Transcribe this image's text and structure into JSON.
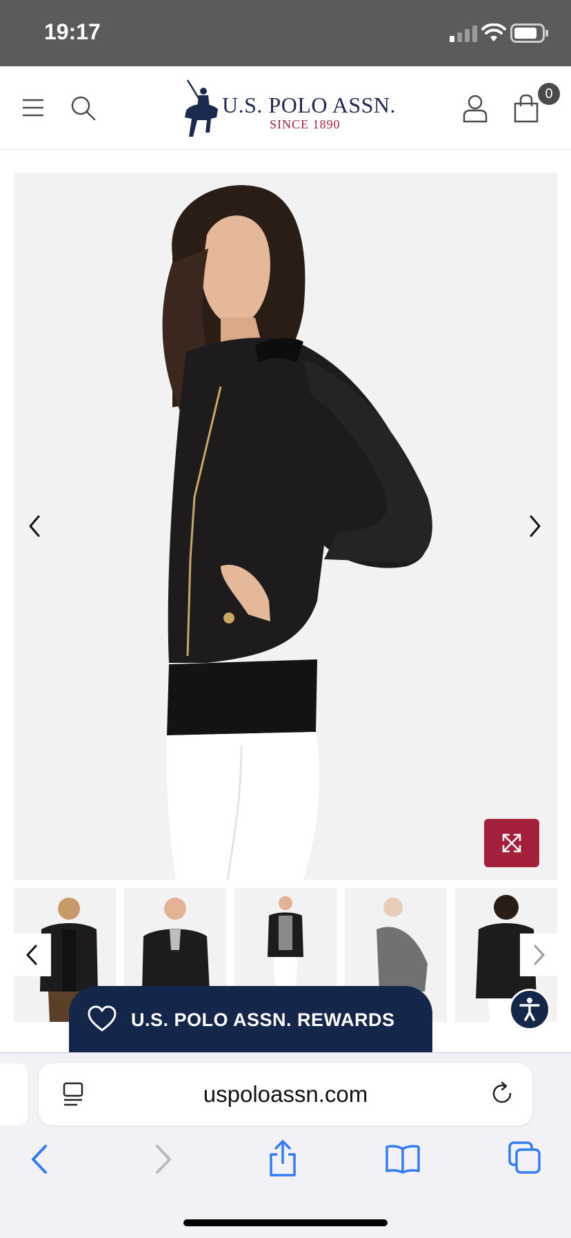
{
  "status_bar": {
    "time": "19:17",
    "icons": [
      "signal-icon",
      "wifi-icon",
      "battery-icon"
    ]
  },
  "header": {
    "menu_icon": "hamburger-menu-icon",
    "search_icon": "search-icon",
    "logo_name": "U.S. POLO ASSN.",
    "logo_since": "SINCE 1890",
    "account_icon": "user-icon",
    "cart_icon": "shopping-bag-icon",
    "cart_count": "0"
  },
  "gallery": {
    "prev_icon": "chevron-left-icon",
    "next_icon": "chevron-right-icon",
    "expand_icon": "expand-icon",
    "thumbnails": [
      {
        "name": "front-open"
      },
      {
        "name": "front-zipped"
      },
      {
        "name": "full-length"
      },
      {
        "name": "side-view"
      },
      {
        "name": "back-view"
      }
    ]
  },
  "rewards": {
    "label": "U.S. POLO ASSN. REWARDS",
    "icon": "heart-icon"
  },
  "accessibility": {
    "icon": "accessibility-icon"
  },
  "browser": {
    "url": "uspoloassn.com",
    "reader_icon": "reader-icon",
    "reload_icon": "reload-icon",
    "toolbar": [
      "back-icon",
      "forward-icon",
      "share-icon",
      "bookmarks-icon",
      "tabs-icon"
    ]
  },
  "colors": {
    "brand_navy": "#14264a",
    "brand_red": "#a3203b",
    "safari_blue": "#2f7cf6"
  }
}
